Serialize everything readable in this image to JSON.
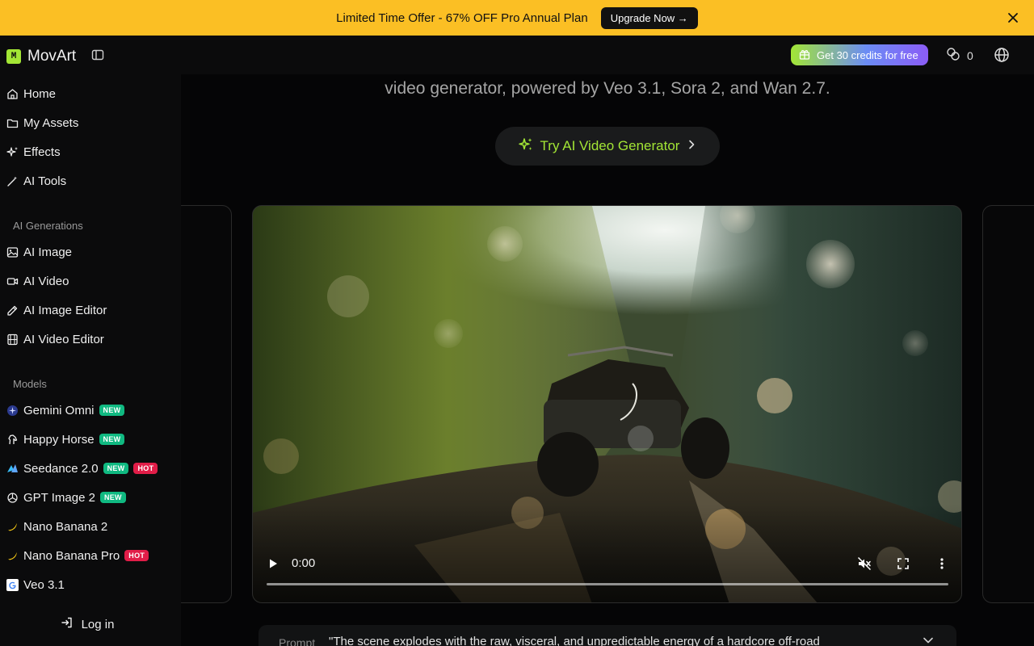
{
  "promo": {
    "text": "Limited Time Offer - 67% OFF Pro Annual Plan",
    "cta": "Upgrade Now →"
  },
  "header": {
    "app_name": "MovArt",
    "logo_glyph": "M",
    "credits_cta": "Get 30 credits for free",
    "credit_count": "0"
  },
  "sidebar": {
    "nav": [
      {
        "label": "Home",
        "icon": "home-icon"
      },
      {
        "label": "My Assets",
        "icon": "folder-icon"
      },
      {
        "label": "Effects",
        "icon": "sparkles-icon"
      },
      {
        "label": "AI Tools",
        "icon": "magic-wand-icon"
      }
    ],
    "section_generations": "AI Generations",
    "generations": [
      {
        "label": "AI Image",
        "icon": "image-icon"
      },
      {
        "label": "AI Video",
        "icon": "video-icon"
      },
      {
        "label": "AI Image Editor",
        "icon": "image-edit-icon"
      },
      {
        "label": "AI Video Editor",
        "icon": "film-icon"
      }
    ],
    "section_models": "Models",
    "models": [
      {
        "label": "Gemini Omni",
        "badges": [
          "NEW"
        ]
      },
      {
        "label": "Happy Horse",
        "badges": [
          "NEW"
        ]
      },
      {
        "label": "Seedance 2.0",
        "badges": [
          "NEW",
          "HOT"
        ]
      },
      {
        "label": "GPT Image 2",
        "badges": [
          "NEW"
        ]
      },
      {
        "label": "Nano Banana 2",
        "badges": []
      },
      {
        "label": "Nano Banana Pro",
        "badges": [
          "HOT"
        ]
      },
      {
        "label": "Veo 3.1",
        "badges": []
      }
    ],
    "login": "Log in"
  },
  "main": {
    "hero_subtitle": "video generator, powered by Veo 3.1, Sora 2, and Wan 2.7.",
    "try_cta": "Try AI Video Generator",
    "video": {
      "time": "0:00",
      "progress": 0
    },
    "prompt_label": "Prompt",
    "prompt_text": "\"The scene explodes with the raw, visceral, and unpredictable energy of a hardcore off-road"
  },
  "colors": {
    "promo_bg": "#fbbf24",
    "accent": "#a3e635",
    "badge_new": "#10b981",
    "badge_hot": "#e11d48"
  }
}
